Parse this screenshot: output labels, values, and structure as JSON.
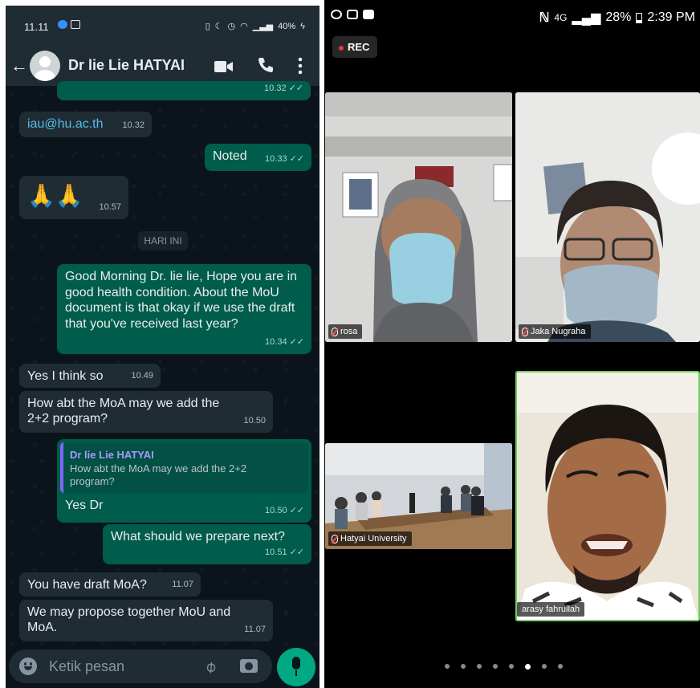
{
  "whatsapp": {
    "status_time": "11.11",
    "status_battery": "40%",
    "contact_name": "Dr lie Lie HATYAI",
    "day_divider": "HARI INI",
    "messages": [
      {
        "text": "",
        "time": "10.32"
      },
      {
        "text": "iau@hu.ac.th",
        "time": "10.32"
      },
      {
        "text": "Noted",
        "time": "10.33"
      },
      {
        "text": "🙏🙏",
        "time": "10.57"
      },
      {
        "text": "Good Morning Dr. lie lie, Hope you are in good health condition. About the MoU document is that okay if we use the draft that you've received last year?",
        "time": "10.34"
      },
      {
        "text": "Yes I think so",
        "time": "10.49"
      },
      {
        "text": "How abt the MoA may we add the 2+2 program?",
        "time": "10.50"
      },
      {
        "quote_name": "Dr lie Lie HATYAI",
        "quote_text": "How abt the MoA may we add the  2+2 program?",
        "text": "Yes Dr",
        "time": "10.50"
      },
      {
        "text": "What should we prepare next?",
        "time": "10.51"
      },
      {
        "text": "You have draft MoA?",
        "time": "11.07"
      },
      {
        "text": "We may propose together MoU and MoA.",
        "time": "11.07"
      }
    ],
    "input_placeholder": "Ketik pesan"
  },
  "zoom": {
    "status_network": "4G",
    "status_battery": "28%",
    "status_time": "2:39 PM",
    "rec_label": "REC",
    "participants": [
      {
        "name": "rosa"
      },
      {
        "name": "Jaka Nugraha"
      },
      {
        "name": "Hatyai University"
      },
      {
        "name": "arasy fahrullah"
      }
    ],
    "page_count": 8,
    "page_active": 6
  },
  "colors": {
    "wa_background": "#0b141a",
    "wa_incoming": "#202c33",
    "wa_outgoing": "#005c4b",
    "wa_accent": "#00a884",
    "zoom_active_speaker": "#6fcf5f",
    "rec_dot": "#e5393a"
  }
}
